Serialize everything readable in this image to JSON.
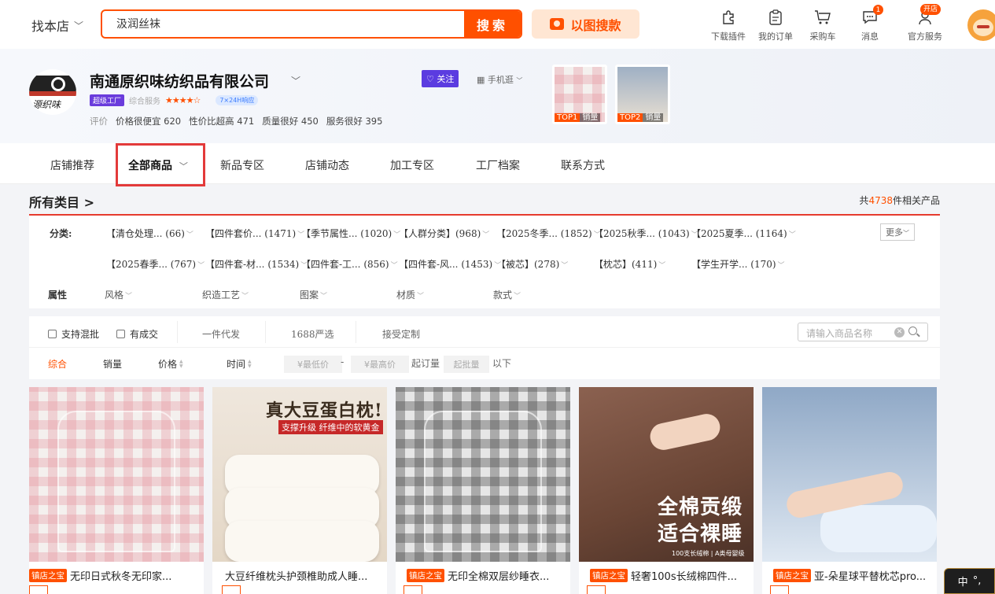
{
  "header": {
    "find_shop": "找本店",
    "search_value": "汲润丝袜",
    "search_button": "搜索",
    "image_search": "以图搜款",
    "nav": [
      {
        "label": "下载插件",
        "icon": "puzzle-icon"
      },
      {
        "label": "我的订单",
        "icon": "order-icon"
      },
      {
        "label": "采购车",
        "icon": "cart-icon"
      },
      {
        "label": "消息",
        "icon": "message-icon",
        "badge": "1"
      },
      {
        "label": "官方服务",
        "icon": "service-icon",
        "badge": "开店"
      }
    ]
  },
  "shop": {
    "logo_text": "源织味",
    "name": "南通原织味纺织品有限公司",
    "badge_factory": "超级工厂",
    "badge_service_label": "综合服务",
    "stars": "★★★★☆",
    "badge_response": "7×24H响应",
    "follow": "关注",
    "mobile": "手机逛",
    "ratings_prefix": "评价",
    "ratings": [
      {
        "label": "价格很便宜",
        "value": "620"
      },
      {
        "label": "性价比超高",
        "value": "471"
      },
      {
        "label": "质量很好",
        "value": "450"
      },
      {
        "label": "服务很好",
        "value": "395"
      }
    ],
    "top_cards": [
      {
        "rank": "TOP1",
        "text": "销量"
      },
      {
        "rank": "TOP2",
        "text": "销量"
      }
    ]
  },
  "tabs": [
    "店铺推荐",
    "全部商品",
    "新品专区",
    "店铺动态",
    "加工专区",
    "工厂档案",
    "联系方式"
  ],
  "category": {
    "title": "所有类目 >",
    "count_prefix": "共",
    "count": "4738",
    "count_suffix": "件相关产品",
    "label_class": "分类:",
    "items_row1": [
      "【清仓处理... (66)",
      "【四件套价... (1471)",
      "【季节属性... (1020)",
      "【人群分类】(968)",
      "【2025冬季... (1852)",
      "【2025秋季... (1043)",
      "【2025夏季... (1164)"
    ],
    "items_row2": [
      "【2025春季... (767)",
      "【四件套-材... (1534)",
      "【四件套-工... (856)",
      "【四件套-风... (1453)",
      "【被芯】(278)",
      "【枕芯】(411)",
      "【学生开学... (170)"
    ],
    "more": "更多",
    "label_attr": "属性",
    "attrs": [
      "风格",
      "织造工艺",
      "图案",
      "材质",
      "款式"
    ]
  },
  "options": {
    "checks": [
      "支持混批",
      "有成交"
    ],
    "tags": [
      "一件代发",
      "1688严选",
      "接受定制"
    ],
    "search_placeholder": "请输入商品名称"
  },
  "sort": {
    "items": [
      "综合",
      "销量",
      "价格",
      "时间"
    ],
    "min_price": "¥最低价",
    "dash": "-",
    "max_price": "¥最高价",
    "moq_label": "起订量",
    "moq_placeholder": "起批量",
    "below": "以下"
  },
  "products": [
    {
      "tag": "镇店之宝",
      "title": "无印日式秋冬无印家..."
    },
    {
      "tag": "",
      "title": "大豆纤维枕头护颈椎助成人睡...",
      "overlay_title": "真大豆蛋白枕!",
      "overlay_sub": "支撑升级 纤维中的软黄金"
    },
    {
      "tag": "镇店之宝",
      "title": "无印全棉双层纱睡衣..."
    },
    {
      "tag": "镇店之宝",
      "title": "轻奢100s长绒棉四件...",
      "overlay_line1": "全棉贡缎",
      "overlay_line2": "适合裸睡",
      "overlay_small": "100支长绒棉 | A类母婴级"
    },
    {
      "tag": "镇店之宝",
      "title": "亚-朵星球平替枕芯pro..."
    }
  ],
  "corner": {
    "text1": "中",
    "text2": "°,"
  }
}
